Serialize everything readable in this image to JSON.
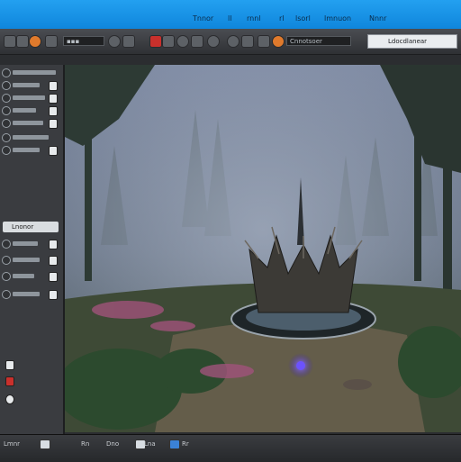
{
  "app": {
    "menu": [
      "Tnnor",
      "ll",
      "rnnl",
      "rl",
      "lsorl",
      "lmnuon",
      "Nnnr"
    ]
  },
  "toolbar": {
    "mode_field": "▪▪▪",
    "search_field": "Cnnotsoer",
    "right_field": "Ldocdlanear"
  },
  "panel": {
    "header": "Lnonor"
  },
  "status": {
    "items": [
      "Lmnr",
      "Rn",
      "Dno",
      "Lna",
      "Rr"
    ]
  },
  "colors": {
    "titlebar": "#1596e6",
    "panel": "#3a3c40",
    "accent_red": "#c9302c",
    "accent_blue": "#2b78c9"
  }
}
